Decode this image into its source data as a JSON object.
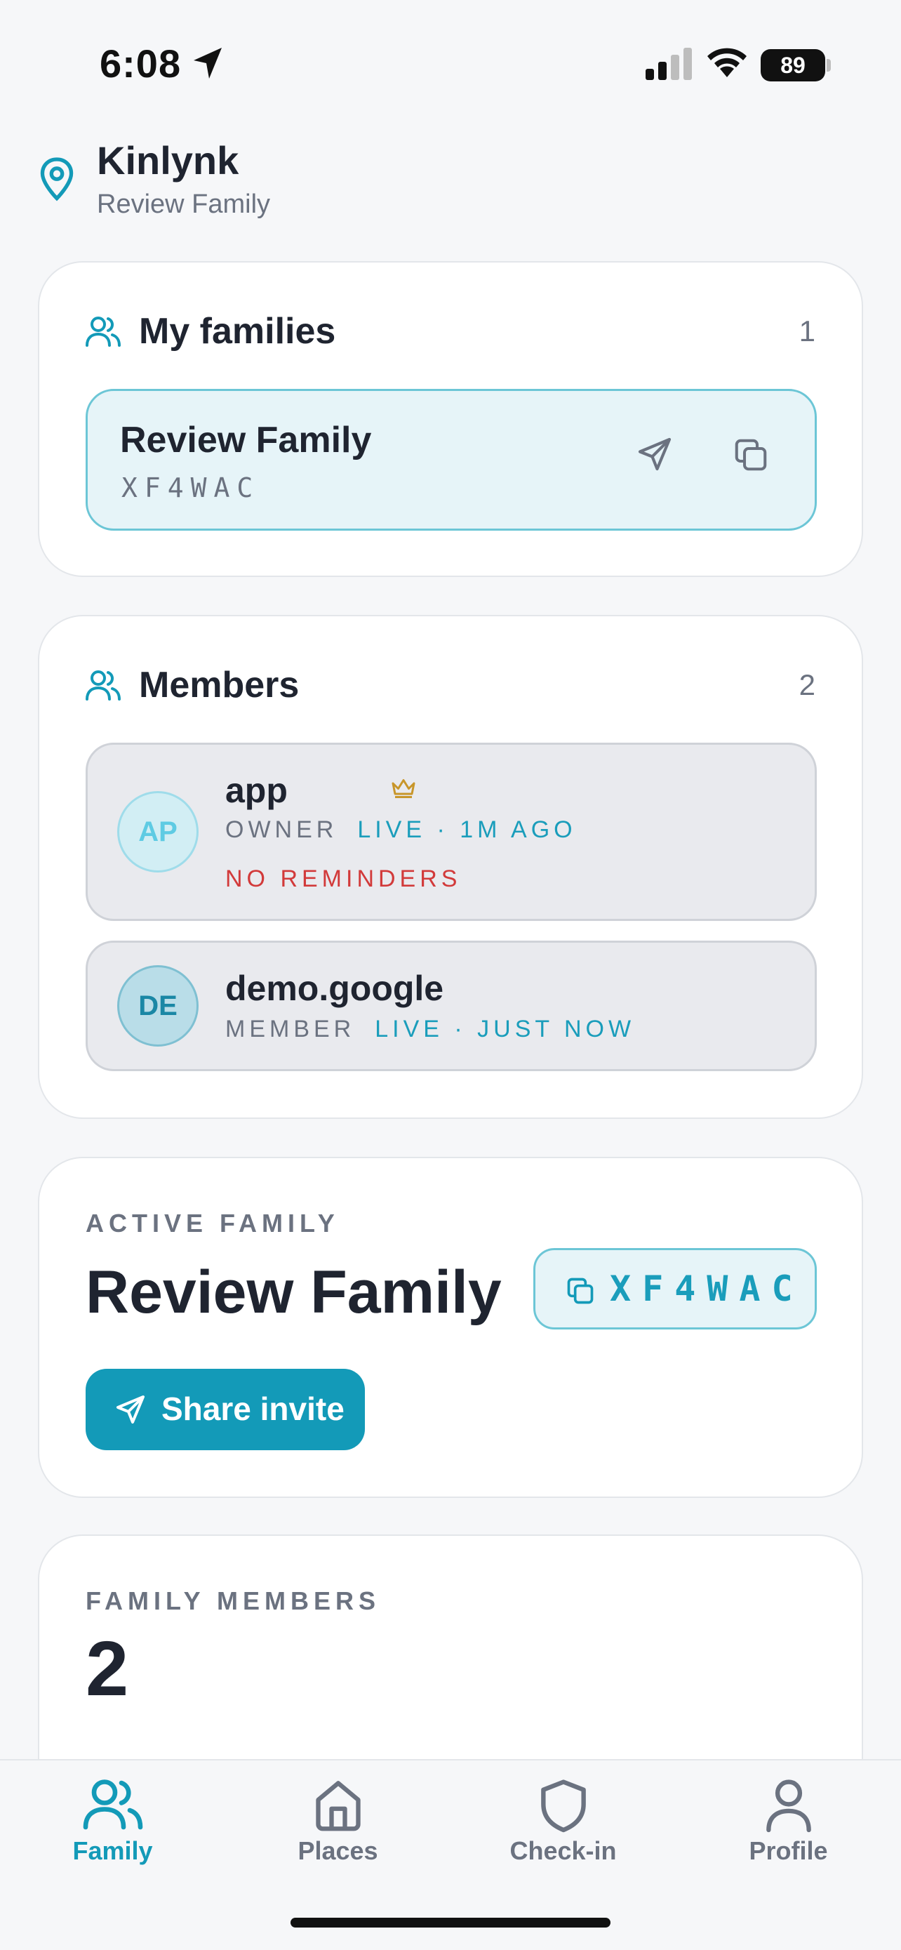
{
  "status": {
    "time": "6:08",
    "battery": "89"
  },
  "header": {
    "title": "Kinlynk",
    "subtitle": "Review Family"
  },
  "families_card": {
    "title": "My families",
    "count": "1",
    "items": [
      {
        "name": "Review Family",
        "code": "XF4WAC"
      }
    ]
  },
  "members_card": {
    "title": "Members",
    "count": "2",
    "items": [
      {
        "initials": "AP",
        "name": "app",
        "role": "OWNER",
        "status": "LIVE · 1M AGO",
        "warning": "NO REMINDERS",
        "owner": true
      },
      {
        "initials": "DE",
        "name": "demo.google",
        "role": "MEMBER",
        "status": "LIVE · JUST NOW"
      }
    ]
  },
  "active_family": {
    "eyebrow": "ACTIVE FAMILY",
    "name": "Review Family",
    "code": "XF4WAC",
    "share_label": "Share invite"
  },
  "family_members": {
    "eyebrow": "FAMILY MEMBERS",
    "count": "2"
  },
  "tabs": [
    {
      "label": "Family",
      "icon": "users-icon",
      "active": true
    },
    {
      "label": "Places",
      "icon": "home-icon"
    },
    {
      "label": "Check-in",
      "icon": "shield-icon"
    },
    {
      "label": "Profile",
      "icon": "user-icon"
    }
  ],
  "colors": {
    "accent": "#139ab8",
    "accent_light": "#e6f4f8",
    "warning": "#d23a3a",
    "owner_crown": "#c8962a"
  }
}
